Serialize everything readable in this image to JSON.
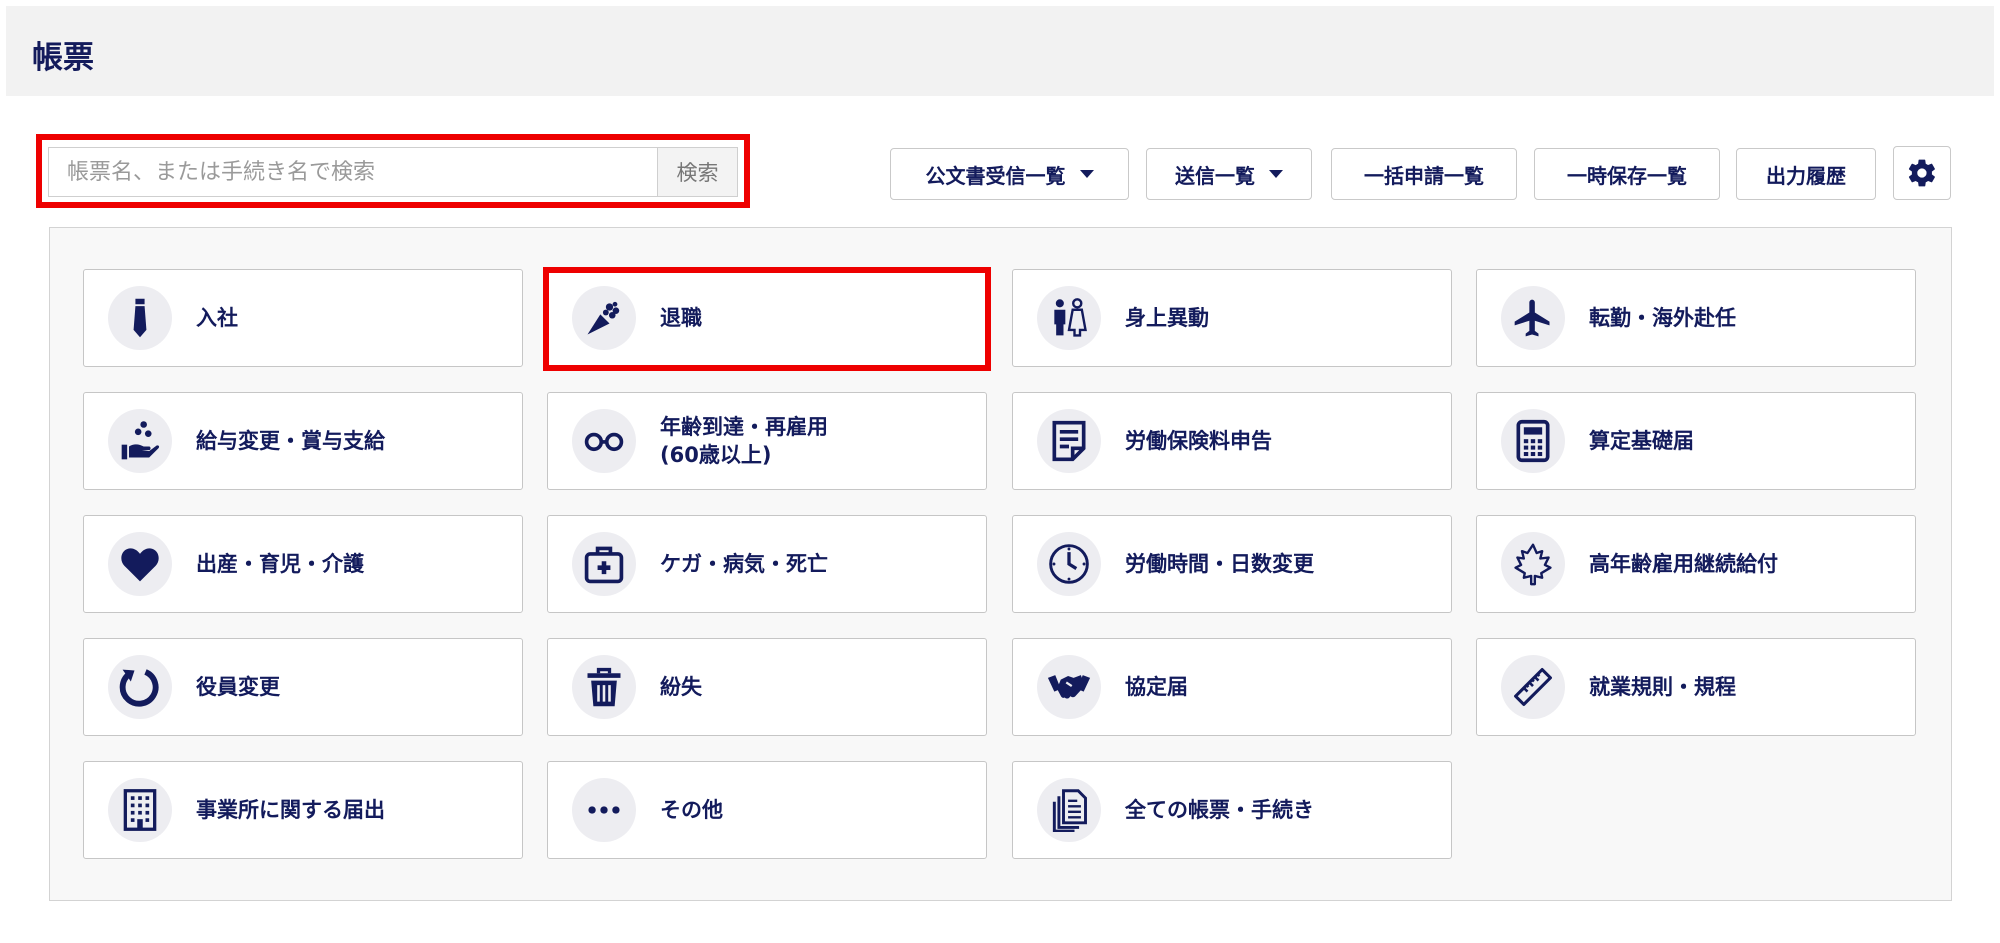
{
  "header": {
    "title": "帳票"
  },
  "search": {
    "placeholder": "帳票名、または手続き名で検索",
    "button": "検索"
  },
  "toolbar": {
    "official_docs": "公文書受信一覧",
    "sent_list": "送信一覧",
    "bulk_list": "一括申請一覧",
    "draft_list": "一時保存一覧",
    "output_history": "出力履歴"
  },
  "cards": [
    {
      "label": "入社",
      "icon": "necktie-icon"
    },
    {
      "label": "退職",
      "icon": "bouquet-icon"
    },
    {
      "label": "身上異動",
      "icon": "couple-icon"
    },
    {
      "label": "転勤・海外赴任",
      "icon": "airplane-icon"
    },
    {
      "label": "給与変更・賞与支給",
      "icon": "hand-coins-icon"
    },
    {
      "label_line1": "年齢到達・再雇用",
      "label_line2": "(60歳以上)",
      "icon": "glasses-icon"
    },
    {
      "label": "労働保険料申告",
      "icon": "document-icon"
    },
    {
      "label": "算定基礎届",
      "icon": "calculator-icon"
    },
    {
      "label": "出産・育児・介護",
      "icon": "heart-icon"
    },
    {
      "label": "ケガ・病気・死亡",
      "icon": "first-aid-kit-icon"
    },
    {
      "label": "労働時間・日数変更",
      "icon": "clock-icon"
    },
    {
      "label": "高年齢雇用継続給付",
      "icon": "maple-leaf-icon"
    },
    {
      "label": "役員変更",
      "icon": "refresh-icon"
    },
    {
      "label": "紛失",
      "icon": "trash-icon"
    },
    {
      "label": "協定届",
      "icon": "handshake-icon"
    },
    {
      "label": "就業規則・規程",
      "icon": "ruler-icon"
    },
    {
      "label": "事業所に関する届出",
      "icon": "building-icon"
    },
    {
      "label": "その他",
      "icon": "more-icon"
    },
    {
      "label": "全ての帳票・手続き",
      "icon": "documents-icon"
    }
  ]
}
